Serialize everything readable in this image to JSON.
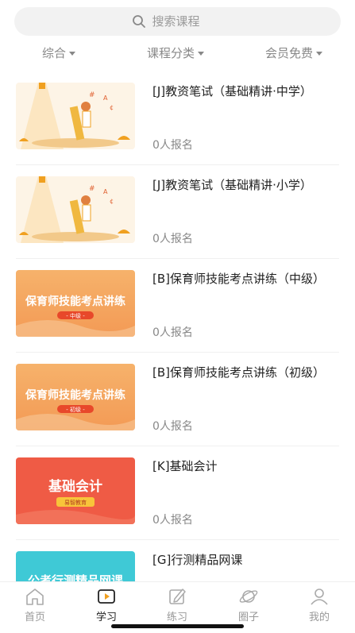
{
  "search": {
    "placeholder": "搜索课程"
  },
  "filters": [
    {
      "label": "综合"
    },
    {
      "label": "课程分类"
    },
    {
      "label": "会员免费"
    }
  ],
  "courses": [
    {
      "title": "[J]教资笔试（基础精讲·中学）",
      "count": "0人报名",
      "thumb": "illustration"
    },
    {
      "title": "[J]教资笔试（基础精讲·小学）",
      "count": "0人报名",
      "thumb": "illustration"
    },
    {
      "title": "[B]保育师技能考点讲练（中级）",
      "count": "0人报名",
      "thumb_text": "保育师技能考点讲练",
      "thumb_badge": "- 中级 -"
    },
    {
      "title": "[B]保育师技能考点讲练（初级）",
      "count": "0人报名",
      "thumb_text": "保育师技能考点讲练",
      "thumb_badge": "- 初级 -"
    },
    {
      "title": "[K]基础会计",
      "count": "0人报名",
      "thumb_text": "基础会计",
      "thumb_badge": "易智教育"
    },
    {
      "title": "[G]行测精品网课",
      "count": "",
      "thumb_text": "公考行测精品网课"
    }
  ],
  "tabs": [
    {
      "label": "首页",
      "icon": "home-icon"
    },
    {
      "label": "学习",
      "icon": "play-icon",
      "active": true
    },
    {
      "label": "练习",
      "icon": "edit-icon"
    },
    {
      "label": "圈子",
      "icon": "planet-icon"
    },
    {
      "label": "我的",
      "icon": "user-icon"
    }
  ],
  "colors": {
    "accent": "#f0a020",
    "orange_thumb": "#f3a05c",
    "red_thumb": "#ef5b45",
    "teal_thumb": "#3fc9d6"
  }
}
